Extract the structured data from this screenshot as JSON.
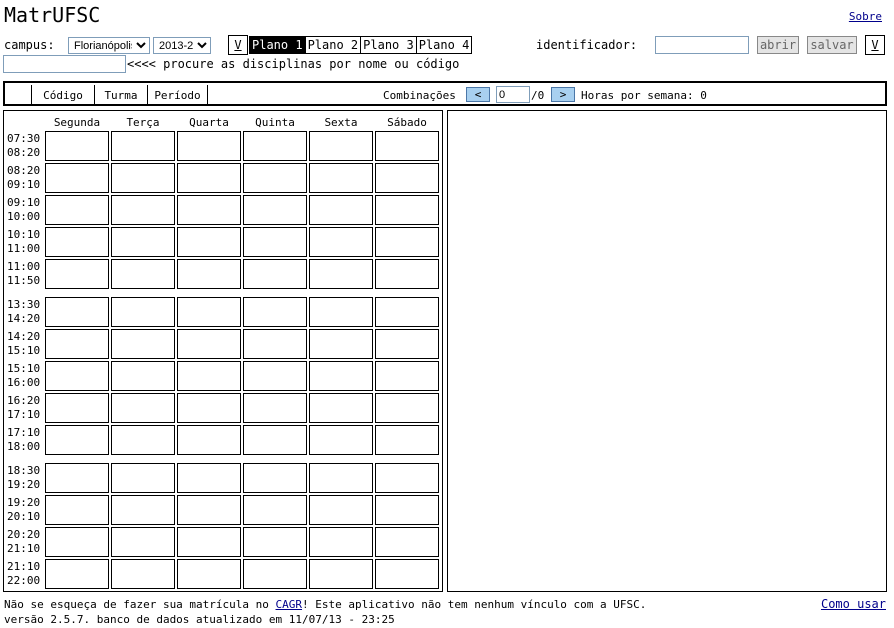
{
  "app_title": "MatrUFSC",
  "sobre_link": "Sobre",
  "campus_label": "campus:",
  "campus_value": "Florianópolis",
  "semester_value": "2013-2",
  "v_button": "V",
  "planos": [
    "Plano 1",
    "Plano 2",
    "Plano 3",
    "Plano 4"
  ],
  "selected_plano": 0,
  "identificador_label": "identificador:",
  "identificador_value": "",
  "abrir_label": "abrir",
  "salvar_label": "salvar",
  "search": {
    "value": "",
    "hint": "<<<< procure as disciplinas por nome ou código"
  },
  "columns": {
    "codigo": "Código",
    "turma": "Turma",
    "periodo": "Período"
  },
  "combinacoes": {
    "label": "Combinações",
    "prev": "<",
    "value": "0",
    "total": "/0",
    "next": ">"
  },
  "horas_label": "Horas por semana: 0",
  "days": [
    "Segunda",
    "Terça",
    "Quarta",
    "Quinta",
    "Sexta",
    "Sábado"
  ],
  "times": [
    [
      "07:30",
      "08:20"
    ],
    [
      "08:20",
      "09:10"
    ],
    [
      "09:10",
      "10:00"
    ],
    [
      "10:10",
      "11:00"
    ],
    [
      "11:00",
      "11:50"
    ],
    [
      "13:30",
      "14:20"
    ],
    [
      "14:20",
      "15:10"
    ],
    [
      "15:10",
      "16:00"
    ],
    [
      "16:20",
      "17:10"
    ],
    [
      "17:10",
      "18:00"
    ],
    [
      "18:30",
      "19:20"
    ],
    [
      "19:20",
      "20:10"
    ],
    [
      "20:20",
      "21:10"
    ],
    [
      "21:10",
      "22:00"
    ]
  ],
  "footer": {
    "line1_before": "Não se esqueça de fazer sua matrícula no ",
    "cagr_link": "CAGR",
    "line1_after": "! Este aplicativo não tem nenhum vínculo com a UFSC.",
    "line2": "versão 2.5.7. banco de dados atualizado em 11/07/13 - 23:25",
    "como_usar": "Como usar"
  }
}
